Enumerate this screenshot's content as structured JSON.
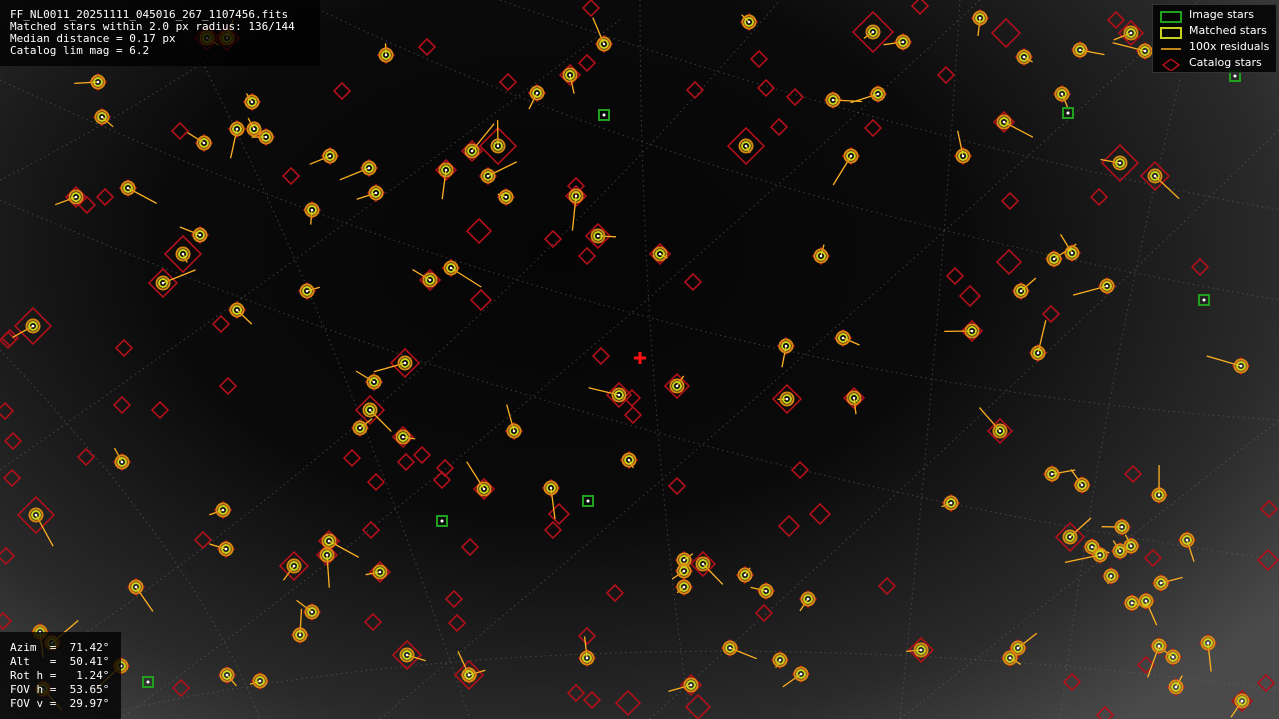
{
  "info": {
    "filename": "FF_NL0011_20251111_045016_267_1107456.fits",
    "matched": "Matched stars within 2.0 px radius: 136/144",
    "median": "Median distance = 0.17 px",
    "limmag": "Catalog lim mag = 6.2"
  },
  "pointing": {
    "azim": "Azim  =  71.42°",
    "alt": "Alt   =  50.41°",
    "roth": "Rot h =   1.24°",
    "fovh": "FOV h =  53.65°",
    "fovv": "FOV v =  29.97°"
  },
  "legend": {
    "image_stars": "Image stars",
    "matched_stars": "Matched stars",
    "residuals": "100x residuals",
    "catalog_stars": "Catalog stars"
  },
  "colors": {
    "image_star": "#1fa01f",
    "matched_outer": "#d98a10",
    "matched_inner": "#c8d21e",
    "residual": "#ffb020",
    "catalog": "#b0101a",
    "center_cross": "#ff1010"
  }
}
